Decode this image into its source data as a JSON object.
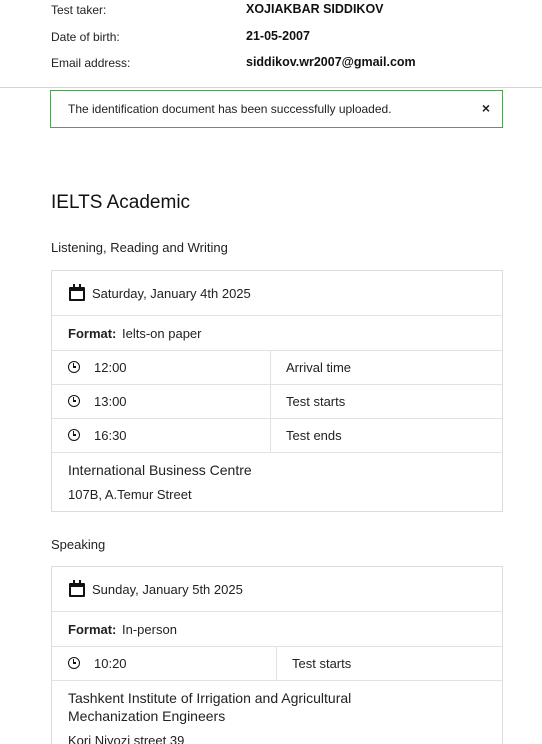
{
  "profile": {
    "test_taker_label": "Test taker:",
    "test_taker_value": "XOJIAKBAR SIDDIKOV",
    "dob_label": "Date of birth:",
    "dob_value": "21-05-2007",
    "email_label": "Email address:",
    "email_value": "siddikov.wr2007@gmail.com"
  },
  "alert": {
    "message": "The identification document has been successfully uploaded.",
    "close_symbol": "×",
    "border_color": "#5a9a5a"
  },
  "exam": {
    "title": "IELTS Academic",
    "lrw": {
      "heading": "Listening, Reading and Writing",
      "date": "Saturday, January 4th 2025",
      "format_label": "Format:",
      "format_value": "Ielts-on paper",
      "times": [
        {
          "time": "12:00",
          "label": "Arrival time"
        },
        {
          "time": "13:00",
          "label": "Test starts"
        },
        {
          "time": "16:30",
          "label": "Test ends"
        }
      ],
      "venue_name": "International Business Centre",
      "venue_address": "107B, A.Temur Street"
    },
    "speaking": {
      "heading": "Speaking",
      "date": "Sunday, January 5th 2025",
      "format_label": "Format:",
      "format_value": "In-person",
      "times": [
        {
          "time": "10:20",
          "label": "Test starts"
        }
      ],
      "venue_name_line1": "Tashkent Institute of Irrigation and Agricultural",
      "venue_name_line2": "Mechanization Engineers",
      "venue_address": "Kori Niyozi street 39"
    }
  }
}
